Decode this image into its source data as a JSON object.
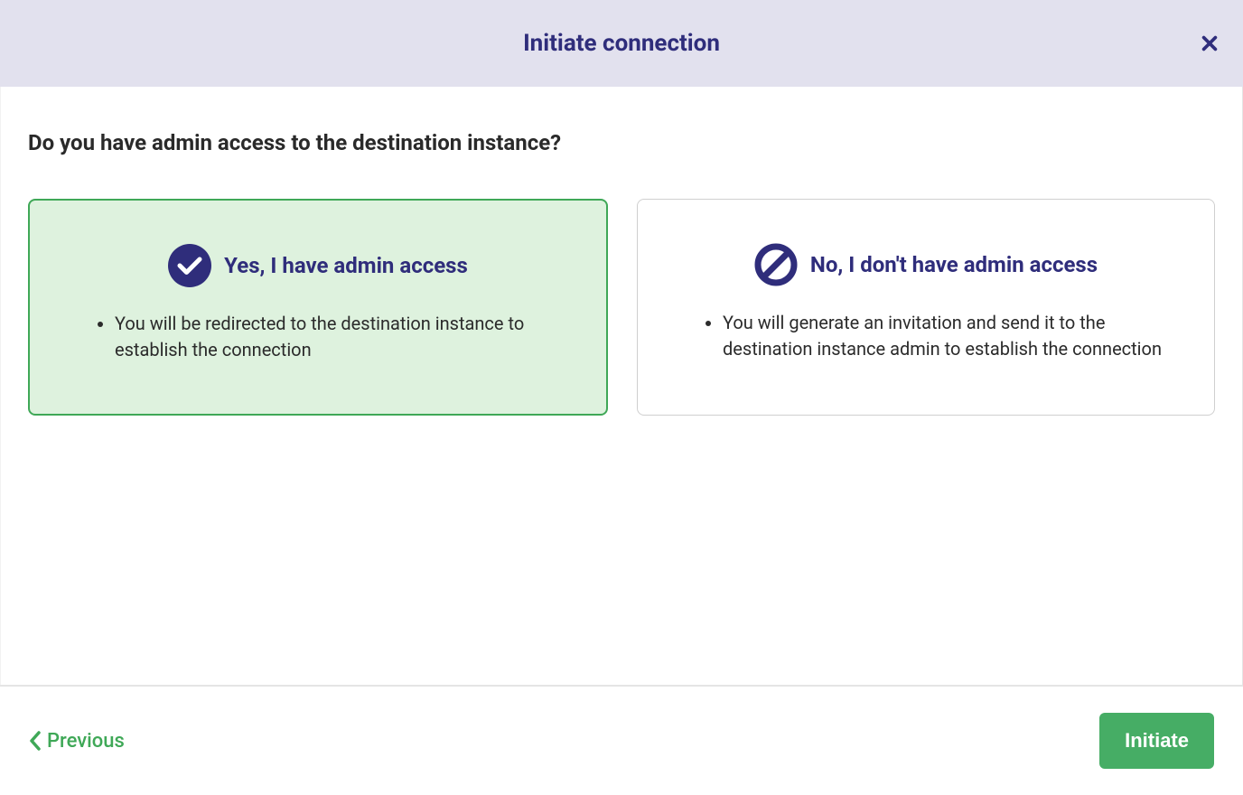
{
  "header": {
    "title": "Initiate connection"
  },
  "question": "Do you have admin access to the destination instance?",
  "options": {
    "yes": {
      "title": "Yes, I have admin access",
      "bullet": "You will be redirected to the destination instance to establish the connection"
    },
    "no": {
      "title": "No, I don't have admin access",
      "bullet": "You will generate an invitation and send it to the destination instance admin to establish the connection"
    }
  },
  "footer": {
    "previous": "Previous",
    "initiate": "Initiate"
  }
}
